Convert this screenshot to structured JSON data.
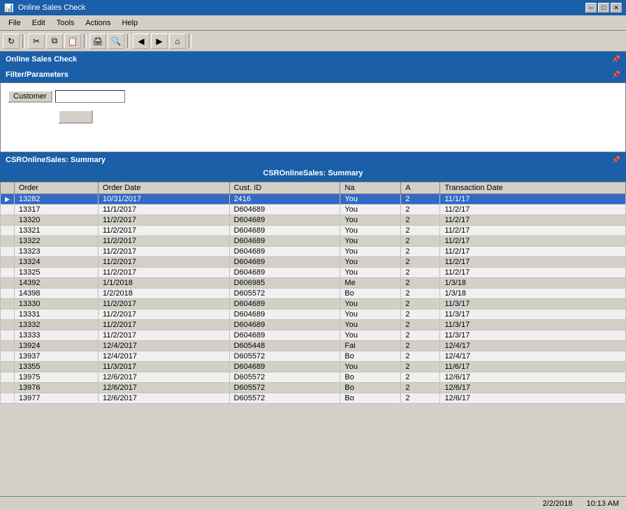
{
  "titleBar": {
    "title": "Online Sales Check",
    "icon": "📊"
  },
  "menuBar": {
    "items": [
      {
        "label": "File",
        "disabled": false
      },
      {
        "label": "Edit",
        "disabled": false
      },
      {
        "label": "Tools",
        "disabled": false
      },
      {
        "label": "Actions",
        "disabled": false
      },
      {
        "label": "Help",
        "disabled": false
      }
    ]
  },
  "toolbar": {
    "buttons": [
      {
        "name": "refresh",
        "icon": "↻"
      },
      {
        "name": "scissors",
        "icon": "✂"
      },
      {
        "name": "copy",
        "icon": "⧉"
      },
      {
        "name": "paste",
        "icon": "📋"
      },
      {
        "name": "print",
        "icon": "🖨"
      },
      {
        "name": "search",
        "icon": "🔍"
      },
      {
        "name": "back",
        "icon": "◀"
      },
      {
        "name": "forward",
        "icon": "▶"
      },
      {
        "name": "home",
        "icon": "⌂"
      }
    ]
  },
  "onlineSalesHeader": "Online Sales Check",
  "filterSection": {
    "header": "Filter/Parameters",
    "customerLabel": "Customer",
    "customerValue": "",
    "applyLabel": ""
  },
  "summarySection": {
    "header": "CSROnlineSales: Summary",
    "tableTitle": "CSROnlineSales: Summary",
    "columns": [
      {
        "key": "order",
        "label": "Order"
      },
      {
        "key": "orderDate",
        "label": "Order Date"
      },
      {
        "key": "custId",
        "label": "Cust. ID"
      },
      {
        "key": "na",
        "label": "Na"
      },
      {
        "key": "a",
        "label": "A"
      },
      {
        "key": "transDate",
        "label": "Transaction Date"
      }
    ],
    "rows": [
      {
        "selected": true,
        "arrow": "▶",
        "order": "13282",
        "orderDate": "10/31/2017",
        "custId": "2416",
        "na": "You",
        "a": "2",
        "transDate": "11/1/17"
      },
      {
        "selected": false,
        "arrow": "",
        "order": "13317",
        "orderDate": "11/1/2017",
        "custId": "D604689",
        "na": "You",
        "a": "2",
        "transDate": "11/2/17"
      },
      {
        "selected": false,
        "arrow": "",
        "order": "13320",
        "orderDate": "11/2/2017",
        "custId": "D604689",
        "na": "You",
        "a": "2",
        "transDate": "11/2/17"
      },
      {
        "selected": false,
        "arrow": "",
        "order": "13321",
        "orderDate": "11/2/2017",
        "custId": "D604689",
        "na": "You",
        "a": "2",
        "transDate": "11/2/17"
      },
      {
        "selected": false,
        "arrow": "",
        "order": "13322",
        "orderDate": "11/2/2017",
        "custId": "D604689",
        "na": "You",
        "a": "2",
        "transDate": "11/2/17"
      },
      {
        "selected": false,
        "arrow": "",
        "order": "13323",
        "orderDate": "11/2/2017",
        "custId": "D604689",
        "na": "You",
        "a": "2",
        "transDate": "11/2/17"
      },
      {
        "selected": false,
        "arrow": "",
        "order": "13324",
        "orderDate": "11/2/2017",
        "custId": "D604689",
        "na": "You",
        "a": "2",
        "transDate": "11/2/17"
      },
      {
        "selected": false,
        "arrow": "",
        "order": "13325",
        "orderDate": "11/2/2017",
        "custId": "D604689",
        "na": "You",
        "a": "2",
        "transDate": "11/2/17"
      },
      {
        "selected": false,
        "arrow": "",
        "order": "14392",
        "orderDate": "1/1/2018",
        "custId": "D606985",
        "na": "Me",
        "a": "2",
        "transDate": "1/3/18"
      },
      {
        "selected": false,
        "arrow": "",
        "order": "14398",
        "orderDate": "1/2/2018",
        "custId": "D605572",
        "na": "Bo",
        "a": "2",
        "transDate": "1/3/18"
      },
      {
        "selected": false,
        "arrow": "",
        "order": "13330",
        "orderDate": "11/2/2017",
        "custId": "D604689",
        "na": "You",
        "a": "2",
        "transDate": "11/3/17"
      },
      {
        "selected": false,
        "arrow": "",
        "order": "13331",
        "orderDate": "11/2/2017",
        "custId": "D604689",
        "na": "You",
        "a": "2",
        "transDate": "11/3/17"
      },
      {
        "selected": false,
        "arrow": "",
        "order": "13332",
        "orderDate": "11/2/2017",
        "custId": "D604689",
        "na": "You",
        "a": "2",
        "transDate": "11/3/17"
      },
      {
        "selected": false,
        "arrow": "",
        "order": "13333",
        "orderDate": "11/2/2017",
        "custId": "D604689",
        "na": "You",
        "a": "2",
        "transDate": "11/3/17"
      },
      {
        "selected": false,
        "arrow": "",
        "order": "13924",
        "orderDate": "12/4/2017",
        "custId": "D605448",
        "na": "Fai",
        "a": "2",
        "transDate": "12/4/17"
      },
      {
        "selected": false,
        "arrow": "",
        "order": "13937",
        "orderDate": "12/4/2017",
        "custId": "D605572",
        "na": "Bo",
        "a": "2",
        "transDate": "12/4/17"
      },
      {
        "selected": false,
        "arrow": "",
        "order": "13355",
        "orderDate": "11/3/2017",
        "custId": "D604689",
        "na": "You",
        "a": "2",
        "transDate": "11/6/17"
      },
      {
        "selected": false,
        "arrow": "",
        "order": "13975",
        "orderDate": "12/6/2017",
        "custId": "D605572",
        "na": "Bo",
        "a": "2",
        "transDate": "12/6/17"
      },
      {
        "selected": false,
        "arrow": "",
        "order": "13976",
        "orderDate": "12/6/2017",
        "custId": "D605572",
        "na": "Bo",
        "a": "2",
        "transDate": "12/6/17"
      },
      {
        "selected": false,
        "arrow": "",
        "order": "13977",
        "orderDate": "12/6/2017",
        "custId": "D605572",
        "na": "Bo",
        "a": "2",
        "transDate": "12/6/17"
      }
    ]
  },
  "statusBar": {
    "date": "2/2/2018",
    "time": "10:13 AM"
  }
}
